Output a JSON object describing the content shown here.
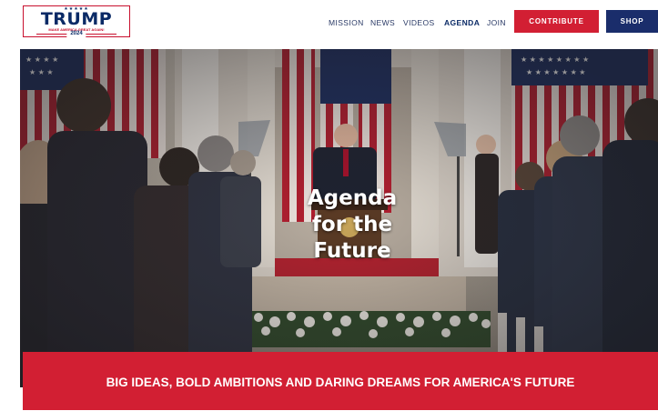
{
  "logo": {
    "stars": "★★★★★",
    "name": "TRUMP",
    "tagline": "MAKE AMERICA GREAT AGAIN!",
    "year": "2024"
  },
  "nav": {
    "items": [
      {
        "label": "MISSION"
      },
      {
        "label": "NEWS"
      },
      {
        "label": "VIDEOS"
      },
      {
        "label": "AGENDA",
        "active": true
      },
      {
        "label": "JOIN"
      }
    ]
  },
  "buttons": {
    "contribute": "CONTRIBUTE",
    "shop": "SHOP"
  },
  "hero": {
    "title_line1": "Agenda",
    "title_line2": "for the",
    "title_line3": "Future"
  },
  "banner": {
    "text": "BIG IDEAS, BOLD AMBITIONS AND DARING DREAMS FOR AMERICA'S FUTURE"
  },
  "colors": {
    "brand_red": "#d21f33",
    "brand_navy": "#1a2d6b",
    "logo_red": "#c8102e"
  }
}
